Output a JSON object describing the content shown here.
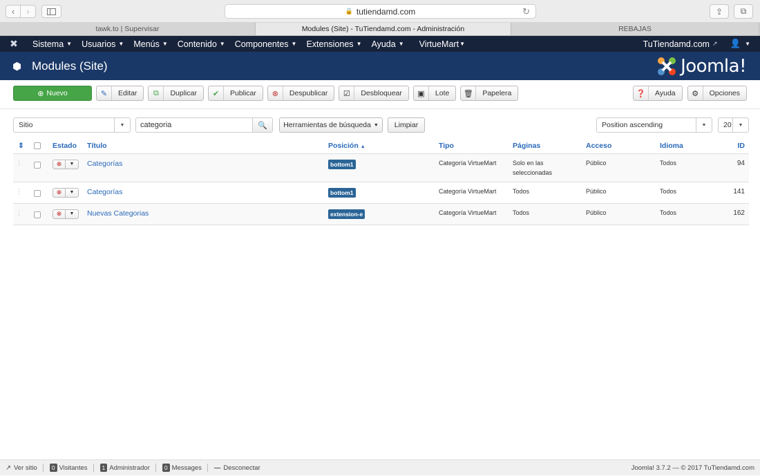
{
  "browser": {
    "url": "tutiendamd.com",
    "tabs": [
      "tawk.to | Supervisar",
      "Modules (Site) - TuTiendamd.com - Administración",
      "REBAJAS"
    ]
  },
  "nav": {
    "items": [
      "Sistema",
      "Usuarios",
      "Menús",
      "Contenido",
      "Componentes",
      "Extensiones",
      "Ayuda",
      "VirtueMart"
    ],
    "site_link": "TuTiendamd.com"
  },
  "header": {
    "title": "Modules (Site)",
    "logo": "Joomla!"
  },
  "toolbar": {
    "new": "Nuevo",
    "edit": "Editar",
    "duplicate": "Duplicar",
    "publish": "Publicar",
    "unpublish": "Despublicar",
    "unlock": "Desbloquear",
    "batch": "Lote",
    "trash": "Papelera",
    "help": "Ayuda",
    "options": "Opciones"
  },
  "filters": {
    "client": "Sitio",
    "search": "categoria",
    "search_tools": "Herramientas de búsqueda",
    "clear": "Limpiar",
    "ordering": "Position ascending",
    "limit": "20"
  },
  "table": {
    "headers": {
      "status": "Estado",
      "title": "Título",
      "position": "Posición",
      "type": "Tipo",
      "pages": "Páginas",
      "access": "Acceso",
      "language": "Idioma",
      "id": "ID"
    },
    "rows": [
      {
        "title": "Categorías",
        "position": "bottom1",
        "type": "Categoría VirtueMart",
        "pages": "Solo en las seleccionadas",
        "access": "Público",
        "language": "Todos",
        "id": "94"
      },
      {
        "title": "Categorías",
        "position": "bottom1",
        "type": "Categoría VirtueMart",
        "pages": "Todos",
        "access": "Público",
        "language": "Todos",
        "id": "141"
      },
      {
        "title": "Nuevas Categorias",
        "position": "extension-e",
        "type": "Categoría VirtueMart",
        "pages": "Todos",
        "access": "Público",
        "language": "Todos",
        "id": "162"
      }
    ]
  },
  "status_bar": {
    "view_site": "Ver sitio",
    "visitors_count": "0",
    "visitors": "Visitantes",
    "admin_count": "1",
    "admin": "Administrador",
    "messages_count": "0",
    "messages": "Messages",
    "logout": "Desconectar",
    "footer": "Joomla! 3.7.2 — © 2017 TuTiendamd.com"
  },
  "colors": {
    "navbar": "#17233b",
    "header": "#1a3867",
    "new_button": "#46a546",
    "link": "#2a69b8",
    "badge": "#2a6496"
  }
}
